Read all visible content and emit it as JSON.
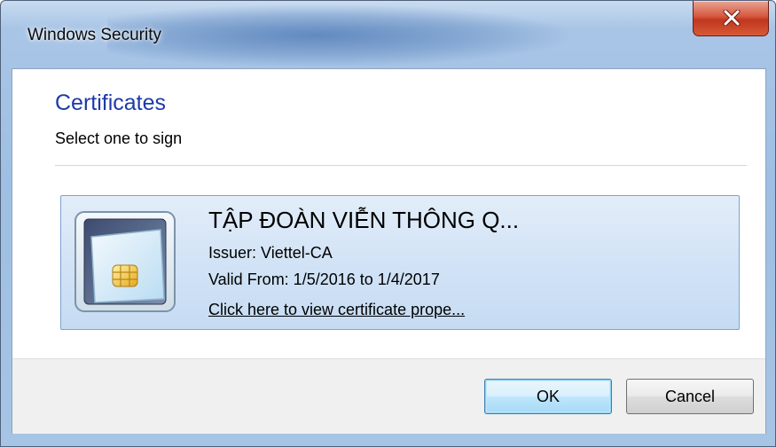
{
  "window": {
    "title": "Windows Security",
    "close_glyph": "x"
  },
  "content": {
    "heading": "Certificates",
    "subheading": "Select one to sign"
  },
  "certificate": {
    "name": "TẬP ĐOÀN VIỄN THÔNG Q...",
    "issuer": "Issuer: Viettel-CA",
    "valid": "Valid From: 1/5/2016 to 1/4/2017",
    "link": "Click here to view certificate prope...",
    "icon": "smart-card-icon"
  },
  "buttons": {
    "ok_label": "OK",
    "cancel_label": "Cancel"
  },
  "colors": {
    "heading_blue": "#1e3aa8",
    "close_red": "#c0371e",
    "selection_blue": "#d2e3f6"
  }
}
